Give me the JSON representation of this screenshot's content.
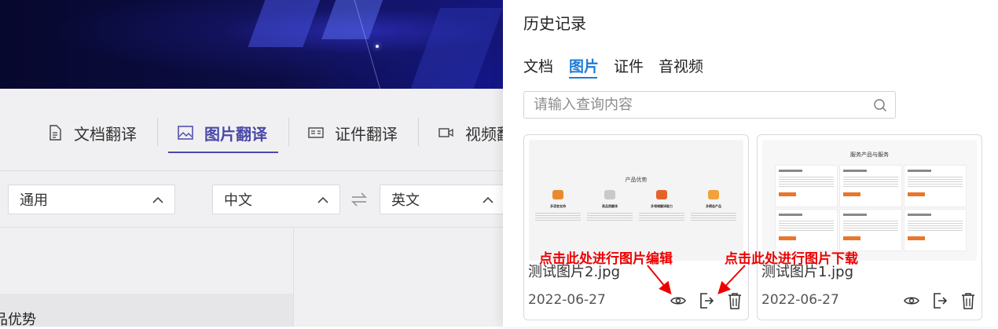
{
  "app": {
    "tabs": [
      {
        "label": "文档翻译",
        "icon": "document-icon"
      },
      {
        "label": "图片翻译",
        "icon": "image-icon",
        "active": true
      },
      {
        "label": "证件翻译",
        "icon": "id-card-icon"
      },
      {
        "label": "视频翻",
        "icon": "video-icon"
      }
    ],
    "domain_select": "通用",
    "source_lang": "中文",
    "target_lang": "英文",
    "cut_text": "品优势"
  },
  "drawer": {
    "title": "历史记录",
    "tabs": [
      "文档",
      "图片",
      "证件",
      "音视频"
    ],
    "active_tab": "图片",
    "search": {
      "placeholder": "请输入查询内容",
      "value": ""
    },
    "cards": [
      {
        "name": "测试图片2.jpg",
        "date": "2022-06-27",
        "thumbnail": {
          "title": "产品优势",
          "features": [
            {
              "name": "多语言支持",
              "color": "#e98a2e"
            },
            {
              "name": "高品质翻译",
              "color": "#c9c9c9"
            },
            {
              "name": "多领域翻译能力",
              "color": "#e4632a"
            },
            {
              "name": "多模态产品",
              "color": "#f0a23b"
            }
          ]
        }
      },
      {
        "name": "测试图片1.jpg",
        "date": "2022-06-27",
        "thumbnail": {
          "title": "服务产品与服务"
        }
      }
    ]
  },
  "annotations": {
    "edit": "点击此处进行图片编辑",
    "download": "点击此处进行图片下载"
  },
  "colors": {
    "accent_app": "#4a49a8",
    "accent_drawer": "#1e7bd6",
    "annotation": "#ee0000"
  }
}
